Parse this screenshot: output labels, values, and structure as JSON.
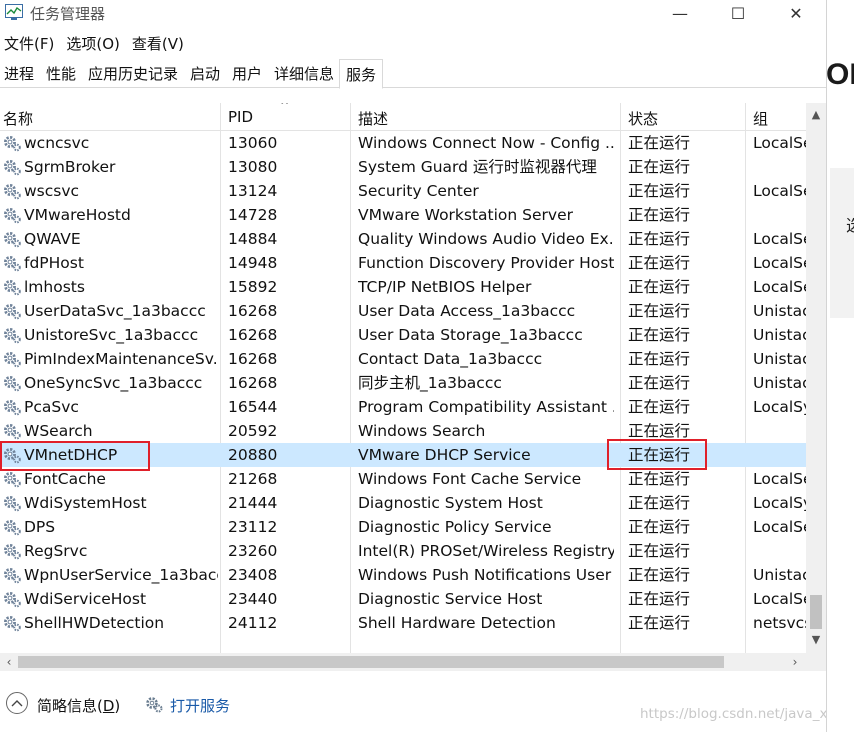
{
  "window": {
    "title": "任务管理器",
    "controls": {
      "minimize": "—",
      "maximize": "☐",
      "close": "✕"
    }
  },
  "menu": {
    "items": [
      {
        "label": "文件(F)",
        "icon": "none"
      },
      {
        "label": "选项(O)",
        "icon": "none"
      },
      {
        "label": "查看(V)",
        "icon": "none"
      }
    ]
  },
  "tabs": [
    {
      "label": "进程"
    },
    {
      "label": "性能"
    },
    {
      "label": "应用历史记录"
    },
    {
      "label": "启动"
    },
    {
      "label": "用户"
    },
    {
      "label": "详细信息"
    },
    {
      "label": "服务",
      "active": true
    }
  ],
  "table": {
    "columns": [
      {
        "label": "名称"
      },
      {
        "label": "PID"
      },
      {
        "label": "描述"
      },
      {
        "label": "状态"
      },
      {
        "label": "组"
      }
    ],
    "sort_indicator": "^",
    "selected_row_index": 13,
    "rows": [
      {
        "name": "wcncsvc",
        "pid": "13060",
        "desc": "Windows Connect Now - Config ...",
        "status": "正在运行",
        "group": "LocalSe"
      },
      {
        "name": "SgrmBroker",
        "pid": "13080",
        "desc": "System Guard 运行时监视器代理",
        "status": "正在运行",
        "group": ""
      },
      {
        "name": "wscsvc",
        "pid": "13124",
        "desc": "Security Center",
        "status": "正在运行",
        "group": "LocalSe"
      },
      {
        "name": "VMwareHostd",
        "pid": "14728",
        "desc": "VMware Workstation Server",
        "status": "正在运行",
        "group": ""
      },
      {
        "name": "QWAVE",
        "pid": "14884",
        "desc": "Quality Windows Audio Video Ex...",
        "status": "正在运行",
        "group": "LocalSe"
      },
      {
        "name": "fdPHost",
        "pid": "14948",
        "desc": "Function Discovery Provider Host",
        "status": "正在运行",
        "group": "LocalSe"
      },
      {
        "name": "lmhosts",
        "pid": "15892",
        "desc": "TCP/IP NetBIOS Helper",
        "status": "正在运行",
        "group": "LocalSe"
      },
      {
        "name": "UserDataSvc_1a3baccc",
        "pid": "16268",
        "desc": "User Data Access_1a3baccc",
        "status": "正在运行",
        "group": "Unistac"
      },
      {
        "name": "UnistoreSvc_1a3baccc",
        "pid": "16268",
        "desc": "User Data Storage_1a3baccc",
        "status": "正在运行",
        "group": "Unistac"
      },
      {
        "name": "PimIndexMaintenanceSv...",
        "pid": "16268",
        "desc": "Contact Data_1a3baccc",
        "status": "正在运行",
        "group": "Unistac"
      },
      {
        "name": "OneSyncSvc_1a3baccc",
        "pid": "16268",
        "desc": "同步主机_1a3baccc",
        "status": "正在运行",
        "group": "Unistac"
      },
      {
        "name": "PcaSvc",
        "pid": "16544",
        "desc": "Program Compatibility Assistant ...",
        "status": "正在运行",
        "group": "LocalSy"
      },
      {
        "name": "WSearch",
        "pid": "20592",
        "desc": "Windows Search",
        "status": "正在运行",
        "group": ""
      },
      {
        "name": "VMnetDHCP",
        "pid": "20880",
        "desc": "VMware DHCP Service",
        "status": "正在运行",
        "group": ""
      },
      {
        "name": "FontCache",
        "pid": "21268",
        "desc": "Windows Font Cache Service",
        "status": "正在运行",
        "group": "LocalSe"
      },
      {
        "name": "WdiSystemHost",
        "pid": "21444",
        "desc": "Diagnostic System Host",
        "status": "正在运行",
        "group": "LocalSy"
      },
      {
        "name": "DPS",
        "pid": "23112",
        "desc": "Diagnostic Policy Service",
        "status": "正在运行",
        "group": "LocalSe"
      },
      {
        "name": "RegSrvc",
        "pid": "23260",
        "desc": "Intel(R) PROSet/Wireless Registry...",
        "status": "正在运行",
        "group": ""
      },
      {
        "name": "WpnUserService_1a3baccc",
        "pid": "23408",
        "desc": "Windows Push Notifications User ...",
        "status": "正在运行",
        "group": "Unistac"
      },
      {
        "name": "WdiServiceHost",
        "pid": "23440",
        "desc": "Diagnostic Service Host",
        "status": "正在运行",
        "group": "LocalSe"
      },
      {
        "name": "ShellHWDetection",
        "pid": "24112",
        "desc": "Shell Hardware Detection",
        "status": "正在运行",
        "group": "netsvcs"
      }
    ],
    "row_icon": "gear-icon"
  },
  "footer": {
    "fewer_details": "简略信息(",
    "fewer_details_key": "D",
    "fewer_details_close": ")",
    "open_services": "打开服务"
  },
  "watermark": "https://blog.csdn.net/java_xxh",
  "background_fragments": {
    "right_top": "ON",
    "right_panel": "选"
  },
  "colors": {
    "selected_row": "#cce8ff",
    "highlight_box": "#e0202a",
    "link": "#1a5aa8"
  }
}
